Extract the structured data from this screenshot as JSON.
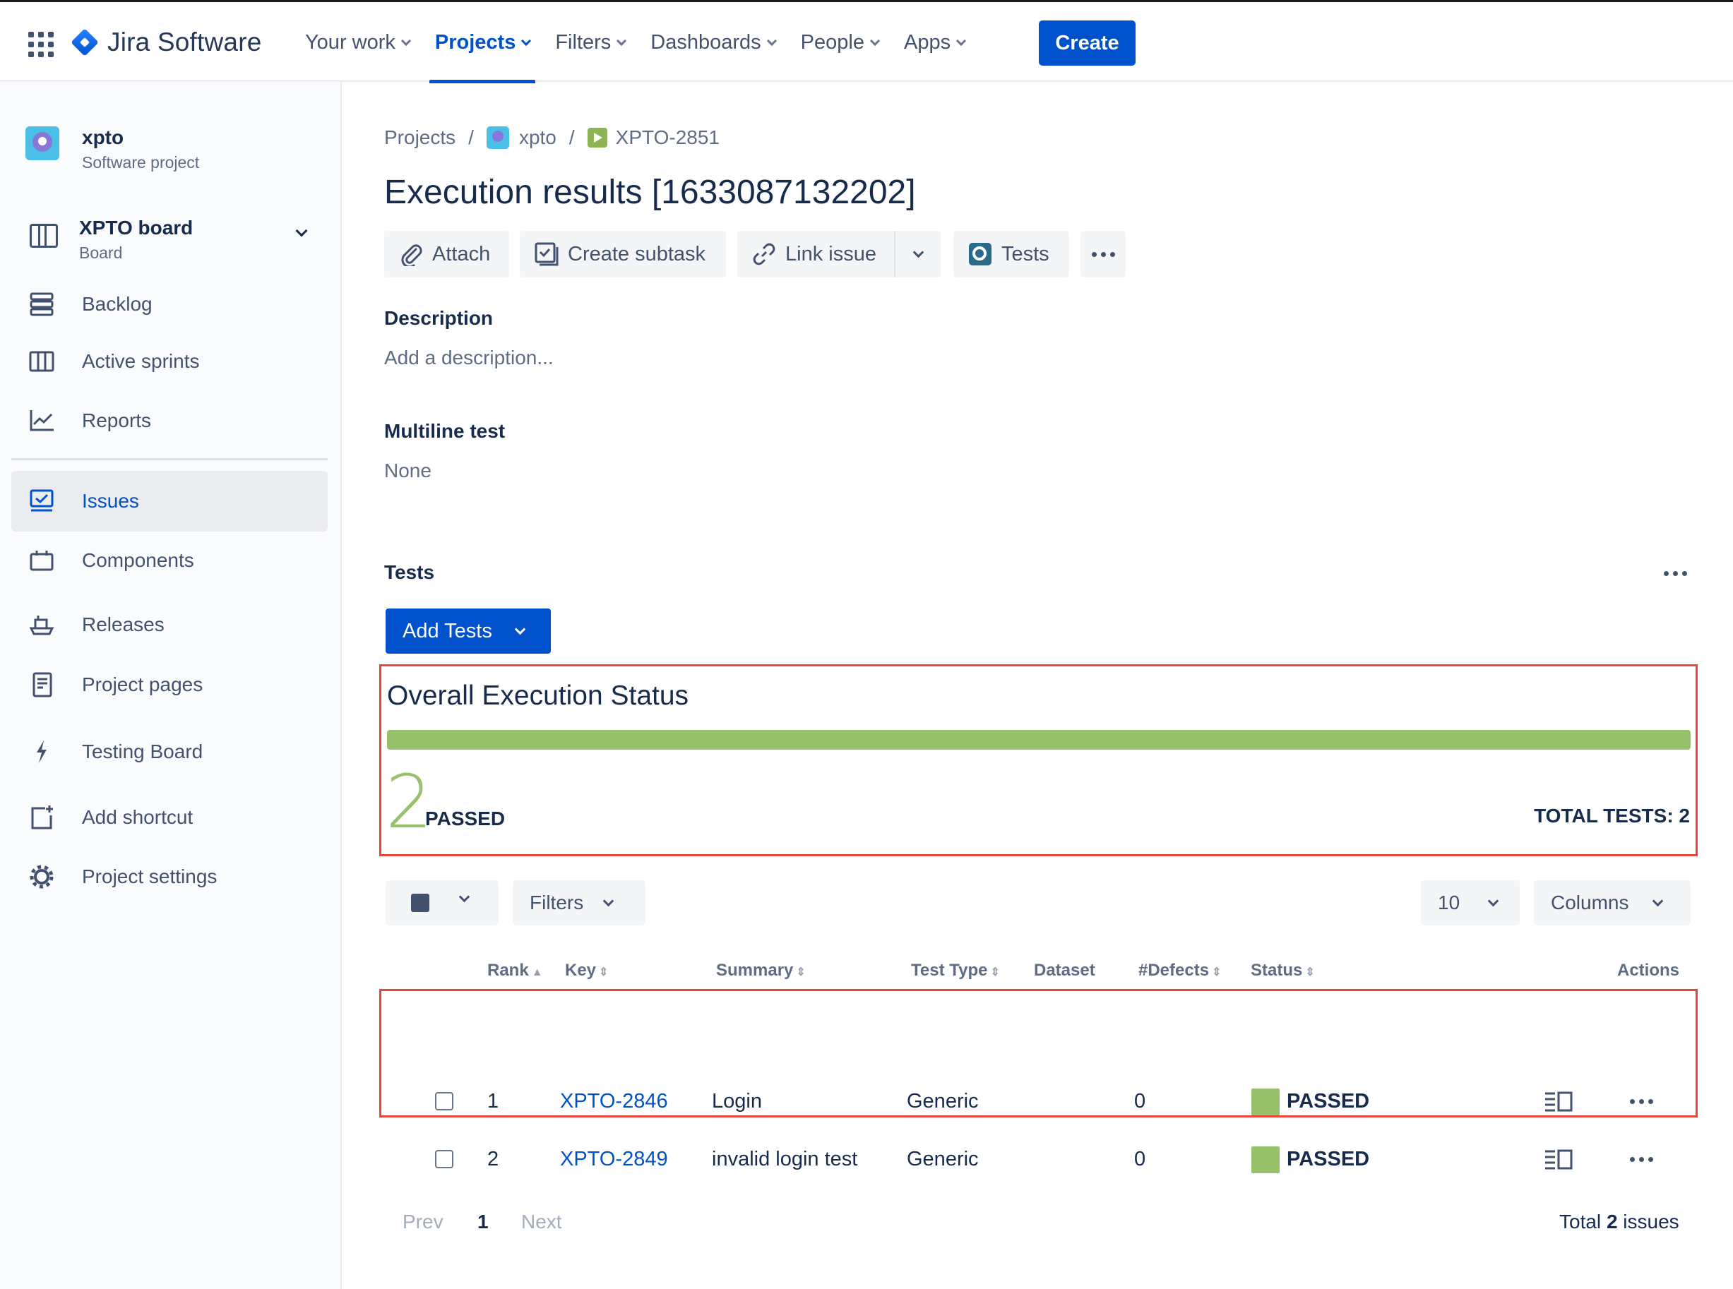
{
  "topnav": {
    "product": "Jira Software",
    "items": [
      {
        "label": "Your work"
      },
      {
        "label": "Projects"
      },
      {
        "label": "Filters"
      },
      {
        "label": "Dashboards"
      },
      {
        "label": "People"
      },
      {
        "label": "Apps"
      }
    ],
    "active_item": "Projects",
    "create_label": "Create"
  },
  "sidebar": {
    "project_name": "xpto",
    "project_type": "Software project",
    "board_name": "XPTO board",
    "board_sub": "Board",
    "items": [
      {
        "label": "Backlog",
        "icon": "backlog-icon"
      },
      {
        "label": "Active sprints",
        "icon": "active-sprints-icon"
      },
      {
        "label": "Reports",
        "icon": "reports-icon"
      },
      {
        "label": "Issues",
        "icon": "issues-icon"
      },
      {
        "label": "Components",
        "icon": "components-icon"
      },
      {
        "label": "Releases",
        "icon": "releases-icon"
      },
      {
        "label": "Project pages",
        "icon": "project-pages-icon"
      },
      {
        "label": "Testing Board",
        "icon": "testing-board-icon"
      },
      {
        "label": "Add shortcut",
        "icon": "add-shortcut-icon"
      },
      {
        "label": "Project settings",
        "icon": "gear-icon"
      }
    ],
    "active_item": "Issues"
  },
  "breadcrumb": {
    "projects": "Projects",
    "project": "xpto",
    "issue": "XPTO-2851",
    "separator": "/"
  },
  "issue": {
    "title": "Execution results [1633087132202]"
  },
  "toolbar": {
    "attach": "Attach",
    "create_subtask": "Create subtask",
    "link_issue": "Link issue",
    "tests": "Tests"
  },
  "fields": {
    "description_label": "Description",
    "description_placeholder": "Add a description...",
    "multiline_label": "Multiline test",
    "multiline_value": "None"
  },
  "tests_section": {
    "heading": "Tests",
    "add_tests": "Add Tests",
    "overall_title": "Overall Execution Status",
    "passed_count": "2",
    "passed_label": "PASSED",
    "total_tests": "TOTAL TESTS: 2",
    "passed_fraction": 1.0,
    "progress_color": "#98c16b"
  },
  "table_controls": {
    "filters": "Filters",
    "page_size": "10",
    "columns": "Columns"
  },
  "table": {
    "columns": [
      "Rank",
      "Key",
      "Summary",
      "Test Type",
      "Dataset",
      "#Defects",
      "Status",
      "Actions"
    ],
    "rows": [
      {
        "rank": "1",
        "key": "XPTO-2846",
        "summary": "Login",
        "test_type": "Generic",
        "dataset": "",
        "defects": "0",
        "status": "PASSED"
      },
      {
        "rank": "2",
        "key": "XPTO-2849",
        "summary": "invalid login test",
        "test_type": "Generic",
        "dataset": "",
        "defects": "0",
        "status": "PASSED"
      }
    ]
  },
  "pager": {
    "prev": "Prev",
    "page": "1",
    "next": "Next",
    "total_prefix": "Total",
    "total_count": "2",
    "total_suffix": "issues"
  },
  "colors": {
    "brand": "#0052cc",
    "passed": "#98c16b",
    "highlight_border": "#e5483b"
  }
}
